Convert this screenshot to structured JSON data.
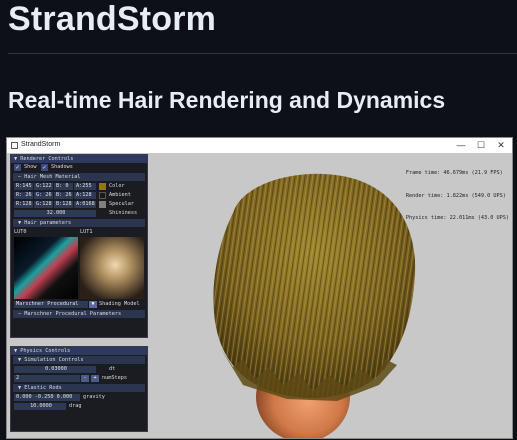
{
  "page": {
    "title": "StrandStorm",
    "subtitle": "Real-time Hair Rendering and Dynamics"
  },
  "window": {
    "title": "StrandStorm",
    "minimize": "—",
    "maximize": "☐",
    "close": "✕"
  },
  "stats": {
    "frame": "Frame time: 46.679ms (21.9 FPS)",
    "render": "Render time: 1.822ms (549.0 UPS)",
    "physics": "Physics time: 22.011ms (43.0 UPS)"
  },
  "renderer": {
    "header": "Renderer Controls",
    "show_label": "Show",
    "shadows_label": "Shadows",
    "material_header": "Hair Mesh Material",
    "rows": [
      {
        "a": "R:145",
        "b": "G:122",
        "c": "B: 0",
        "d": "A:255",
        "label": "Color",
        "swatch": "#917a00"
      },
      {
        "a": "R: 26",
        "b": "G: 26",
        "c": "B: 26",
        "d": "A:128",
        "label": "Ambient",
        "swatch": "#1a1a1a"
      },
      {
        "a": "R:128",
        "b": "G:128",
        "c": "B:128",
        "d": "A:0168",
        "label": "Specular",
        "swatch": "#808080"
      }
    ],
    "shininess_value": "32.000",
    "shininess_label": "Shininess",
    "hair_params_header": "Hair parameters",
    "lut0": "LUT0",
    "lut1": "LUT1",
    "shading_model_value": "Marschner Procedural",
    "shading_model_label": "Shading Model",
    "procedural_header": "Marschner Procedural Parameters"
  },
  "physics": {
    "header": "Physics Controls",
    "sim_header": "Simulation Controls",
    "dt_value": "0.03000",
    "dt_label": "dt",
    "steps_value": "2",
    "steps_minus": "-",
    "steps_plus": "+",
    "steps_label": "numSteps",
    "elastic_header": "Elastic Rods",
    "gravity_value": "0.000 -0.250 0.000",
    "gravity_label": "gravity",
    "drag_value": "10.0000",
    "drag_label": "drag"
  },
  "colors": {
    "hair": "#8a7020",
    "head": "#e09060",
    "panel_header": "#2d3a5e"
  }
}
